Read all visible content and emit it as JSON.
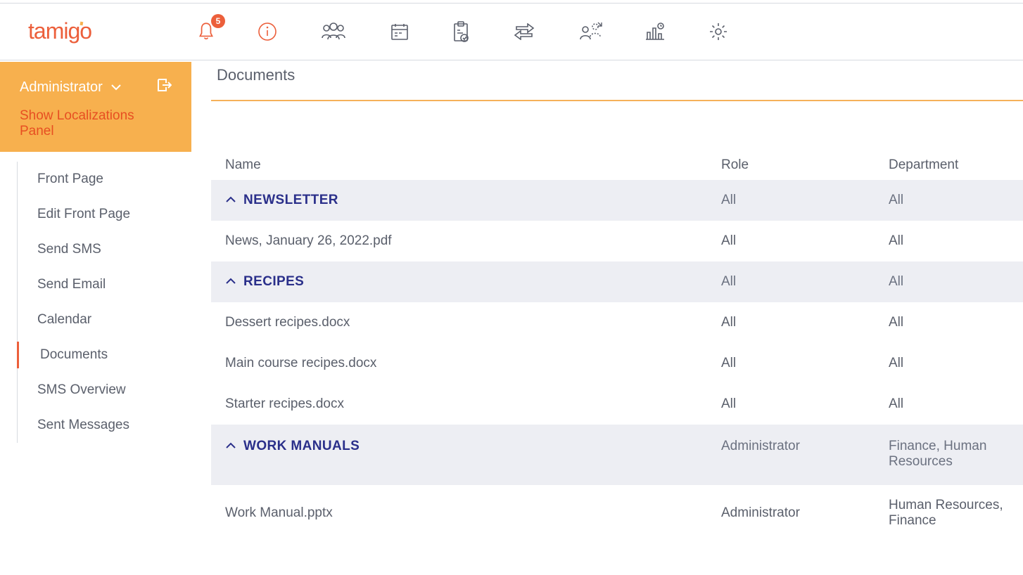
{
  "brand": "tamigo",
  "notification_count": "5",
  "sidebar_header": {
    "role_label": "Administrator",
    "loc_panel": "Show Localizations Panel"
  },
  "sidebar": {
    "items": [
      {
        "label": "Front Page"
      },
      {
        "label": "Edit Front Page"
      },
      {
        "label": "Send SMS"
      },
      {
        "label": "Send Email"
      },
      {
        "label": "Calendar"
      },
      {
        "label": "Documents"
      },
      {
        "label": "SMS Overview"
      },
      {
        "label": "Sent Messages"
      }
    ]
  },
  "page": {
    "title": "Documents"
  },
  "table": {
    "headers": {
      "name": "Name",
      "role": "Role",
      "dept": "Department"
    },
    "groups": [
      {
        "title": "NEWSLETTER",
        "role": "All",
        "dept": "All",
        "rows": [
          {
            "name": "News, January 26, 2022.pdf",
            "role": "All",
            "dept": "All"
          }
        ]
      },
      {
        "title": "RECIPES",
        "role": "All",
        "dept": "All",
        "rows": [
          {
            "name": "Dessert recipes.docx",
            "role": "All",
            "dept": "All"
          },
          {
            "name": "Main course recipes.docx",
            "role": "All",
            "dept": "All"
          },
          {
            "name": "Starter recipes.docx",
            "role": "All",
            "dept": "All"
          }
        ]
      },
      {
        "title": "WORK MANUALS",
        "role": "Administrator",
        "dept": "Finance, Human Resources",
        "rows": [
          {
            "name": "Work Manual.pptx",
            "role": "Administrator",
            "dept": "Human Resources, Finance"
          }
        ]
      }
    ]
  }
}
